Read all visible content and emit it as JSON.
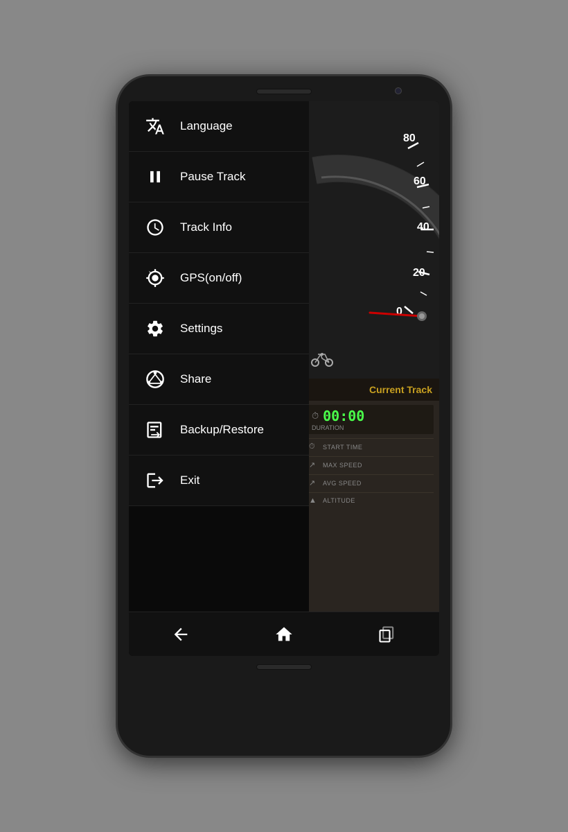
{
  "phone": {
    "background_color": "#1a1a1a"
  },
  "menu": {
    "items": [
      {
        "id": "language",
        "label": "Language",
        "icon": "language"
      },
      {
        "id": "pause-track",
        "label": "Pause Track",
        "icon": "pause"
      },
      {
        "id": "track-info",
        "label": "Track Info",
        "icon": "track-info"
      },
      {
        "id": "gps",
        "label": "GPS(on/off)",
        "icon": "gps"
      },
      {
        "id": "settings",
        "label": "Settings",
        "icon": "settings"
      },
      {
        "id": "share",
        "label": "Share",
        "icon": "share"
      },
      {
        "id": "backup",
        "label": "Backup/Restore",
        "icon": "backup"
      },
      {
        "id": "exit",
        "label": "Exit",
        "icon": "exit"
      }
    ]
  },
  "speedometer": {
    "labels": [
      "80",
      "60",
      "40",
      "20",
      "0"
    ],
    "refresh_icon": "↺"
  },
  "current_track": {
    "header": "Current Track",
    "speed_value": "00:00",
    "speed_label": "DURATION",
    "stats": [
      {
        "icon": "⏱",
        "label": "START TIME"
      },
      {
        "icon": "↗",
        "label": "MAX SPEED"
      },
      {
        "icon": "↗",
        "label": "AVG SPEED"
      },
      {
        "icon": "▲",
        "label": "ALTITUDE"
      }
    ]
  },
  "navbar": {
    "back_label": "←",
    "home_label": "⌂",
    "recent_label": "◫"
  }
}
